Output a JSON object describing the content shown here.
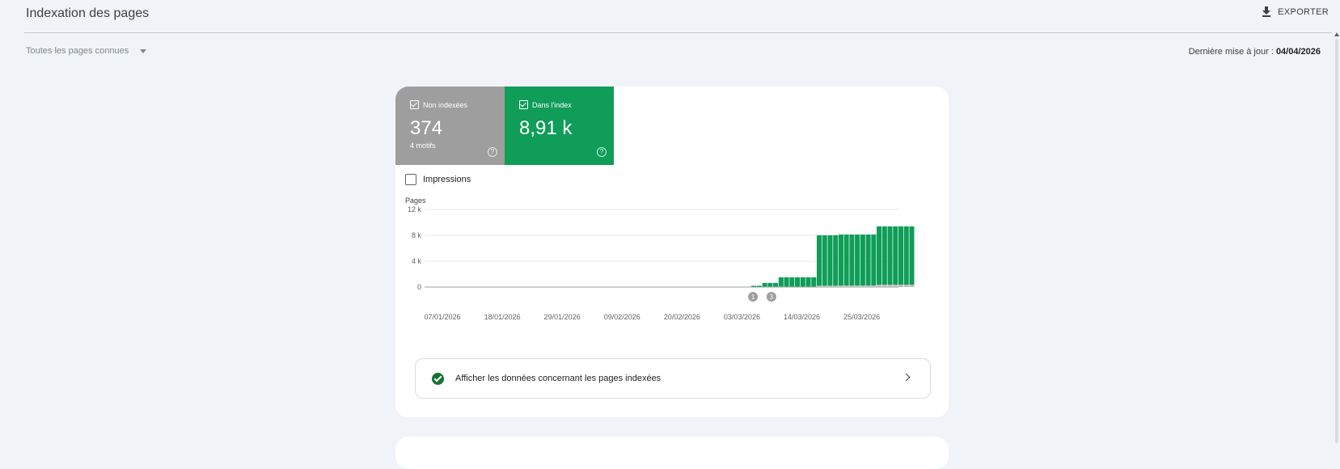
{
  "header": {
    "title": "Indexation des pages",
    "export_label": "EXPORTER"
  },
  "filter": {
    "selected": "Toutes les pages connues"
  },
  "last_update": {
    "label": "Dernière mise à jour :",
    "date": "04/04/2026"
  },
  "tiles": {
    "non_indexed": {
      "label": "Non indexées",
      "value": "374",
      "sub": "4 motifs",
      "color": "#9e9e9e"
    },
    "indexed": {
      "label": "Dans l'index",
      "value": "8,91 k",
      "color": "#0f9d58"
    }
  },
  "impressions_label": "Impressions",
  "chart_data": {
    "type": "bar",
    "ylabel": "Pages",
    "ylim": [
      0,
      12000
    ],
    "yticks": [
      0,
      4000,
      8000,
      12000
    ],
    "ytick_labels": [
      "0",
      "4 k",
      "8 k",
      "12 k"
    ],
    "xtick_labels": [
      "07/01/2026",
      "18/01/2026",
      "29/01/2026",
      "09/02/2026",
      "20/02/2026",
      "03/03/2026",
      "14/03/2026",
      "25/03/2026"
    ],
    "x_start": "07/01/2026",
    "x_end": "03/04/2026",
    "bars_start": "08/03/2026",
    "series": [
      {
        "name": "Dans l'index",
        "color": "#0f9d58",
        "values": [
          180,
          180,
          600,
          600,
          600,
          1450,
          1450,
          1450,
          1450,
          1450,
          1450,
          1450,
          7800,
          7800,
          7800,
          7800,
          7900,
          7900,
          7900,
          7900,
          7900,
          7900,
          7900,
          9000,
          9000,
          9000,
          9000,
          9000,
          9000,
          9000
        ]
      },
      {
        "name": "Non indexées",
        "color": "#bdbdbd",
        "values": [
          20,
          20,
          40,
          40,
          40,
          60,
          60,
          60,
          60,
          60,
          60,
          60,
          200,
          200,
          200,
          200,
          220,
          220,
          220,
          220,
          220,
          220,
          220,
          374,
          374,
          374,
          374,
          374,
          374,
          374
        ]
      }
    ],
    "annotations": [
      {
        "label": "1",
        "date": "08/03/2026"
      },
      {
        "label": "3",
        "date": "09/03/2026"
      }
    ]
  },
  "indexed_link_label": "Afficher les données concernant les pages indexées"
}
